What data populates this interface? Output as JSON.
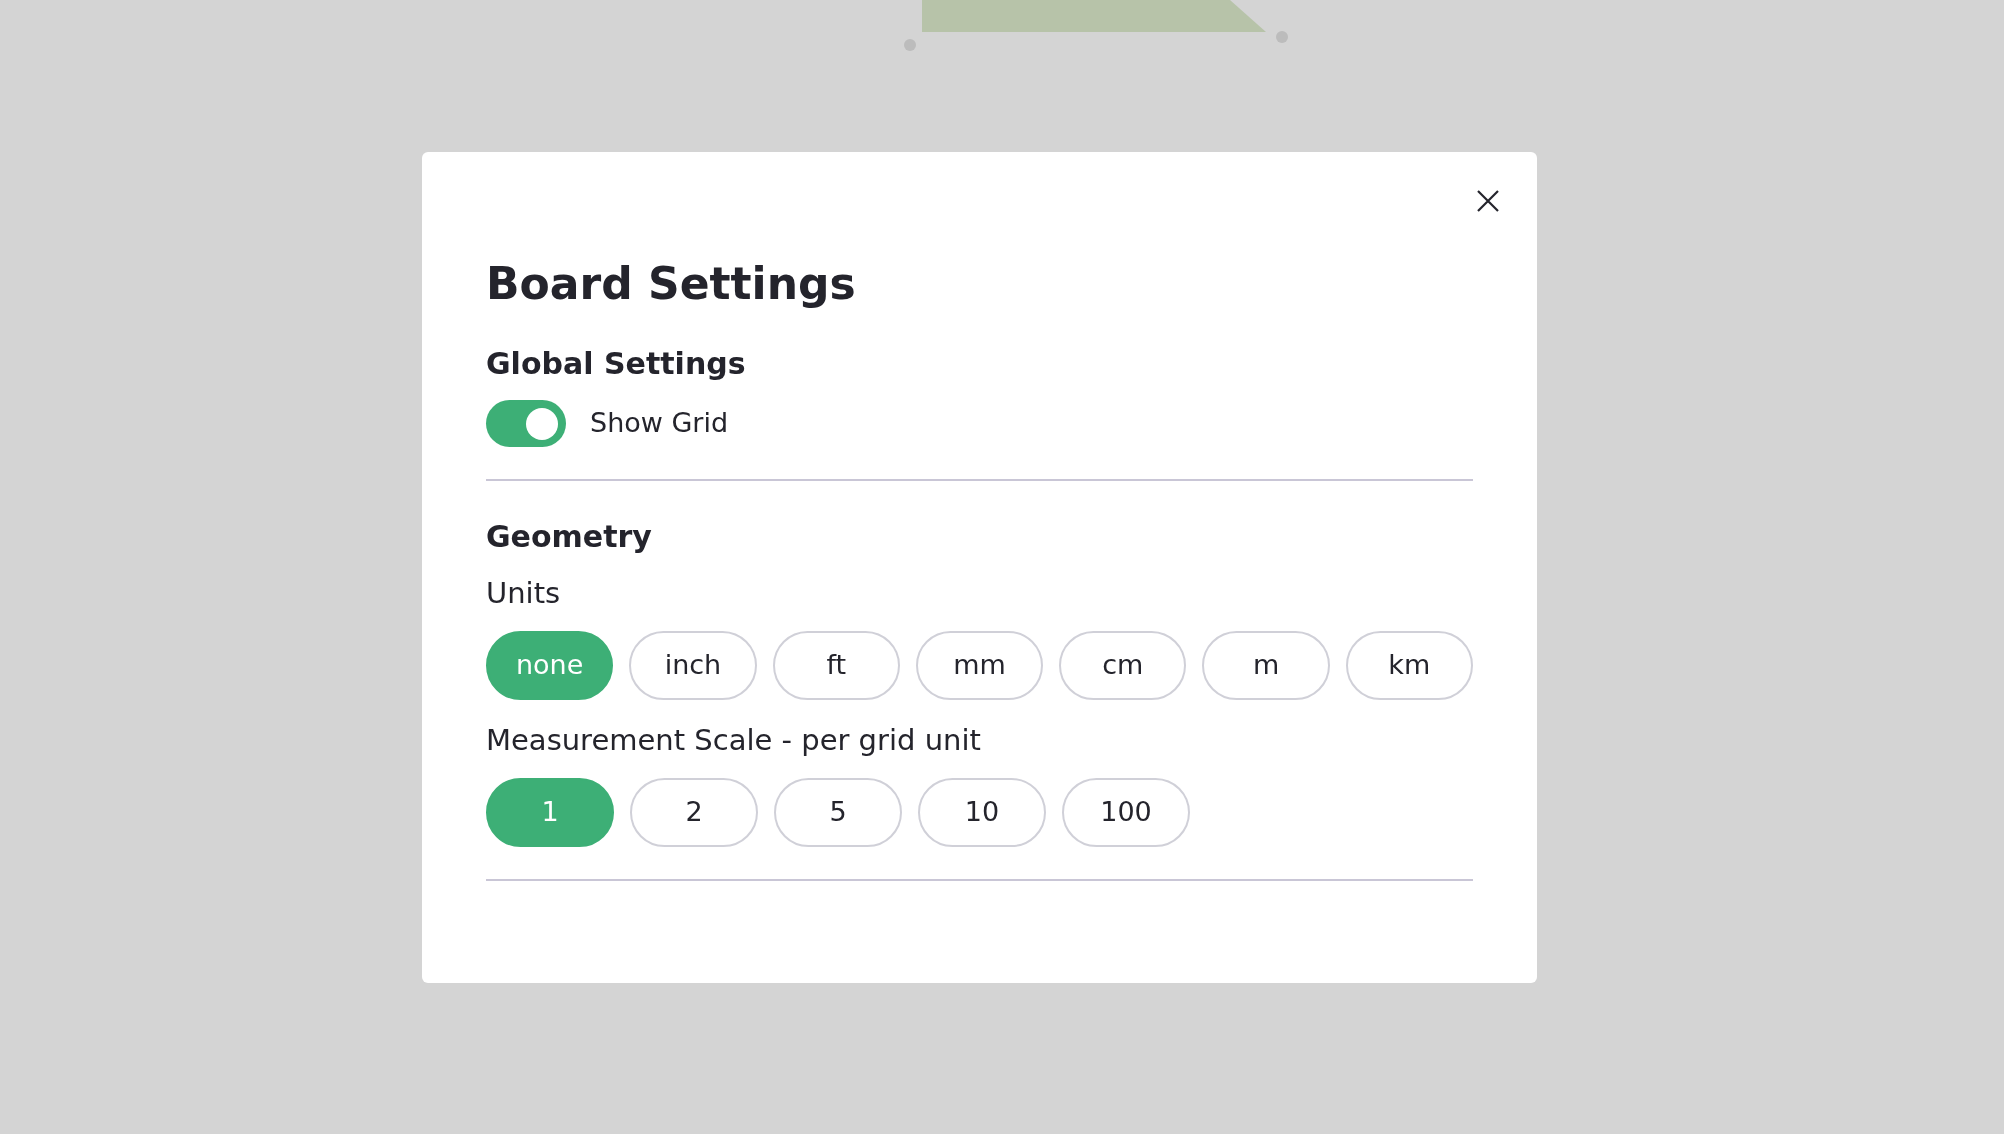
{
  "dialog": {
    "title": "Board Settings",
    "sections": [
      {
        "heading": "Global Settings",
        "toggle": {
          "label": "Show Grid",
          "on": true
        }
      },
      {
        "heading": "Geometry",
        "groups": [
          {
            "label": "Units",
            "options": [
              {
                "label": "none",
                "selected": true
              },
              {
                "label": "inch",
                "selected": false
              },
              {
                "label": "ft",
                "selected": false
              },
              {
                "label": "mm",
                "selected": false
              },
              {
                "label": "cm",
                "selected": false
              },
              {
                "label": "m",
                "selected": false
              },
              {
                "label": "km",
                "selected": false
              }
            ]
          },
          {
            "label": "Measurement Scale - per grid unit",
            "options": [
              {
                "label": "1",
                "selected": true
              },
              {
                "label": "2",
                "selected": false
              },
              {
                "label": "5",
                "selected": false
              },
              {
                "label": "10",
                "selected": false
              },
              {
                "label": "100",
                "selected": false
              }
            ]
          }
        ]
      }
    ]
  }
}
